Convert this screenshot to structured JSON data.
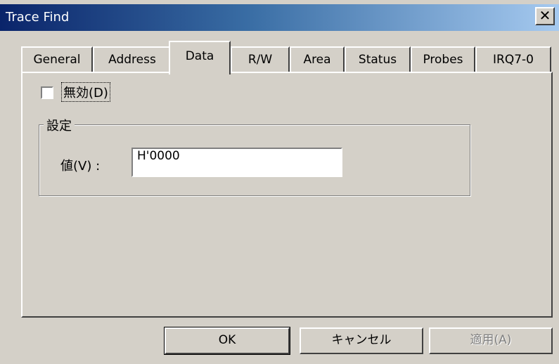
{
  "window": {
    "title": "Trace Find",
    "close_glyph": "✕"
  },
  "tabs": [
    {
      "label": "General",
      "active": false
    },
    {
      "label": "Address",
      "active": false
    },
    {
      "label": "Data",
      "active": true
    },
    {
      "label": "R/W",
      "active": false
    },
    {
      "label": "Area",
      "active": false
    },
    {
      "label": "Status",
      "active": false
    },
    {
      "label": "Probes",
      "active": false
    },
    {
      "label": "IRQ7-0",
      "active": false
    }
  ],
  "panel": {
    "disable_checkbox": {
      "label": "無効(D)",
      "checked": false
    },
    "settings_group": {
      "title": "設定",
      "value_label": "値(V) :",
      "value": "H'0000"
    }
  },
  "buttons": {
    "ok": "OK",
    "cancel": "キャンセル",
    "apply": "適用(A)"
  },
  "colors": {
    "dialog_bg": "#d4d0c8",
    "titlebar_start": "#0a246a",
    "titlebar_end": "#a6caf0"
  }
}
